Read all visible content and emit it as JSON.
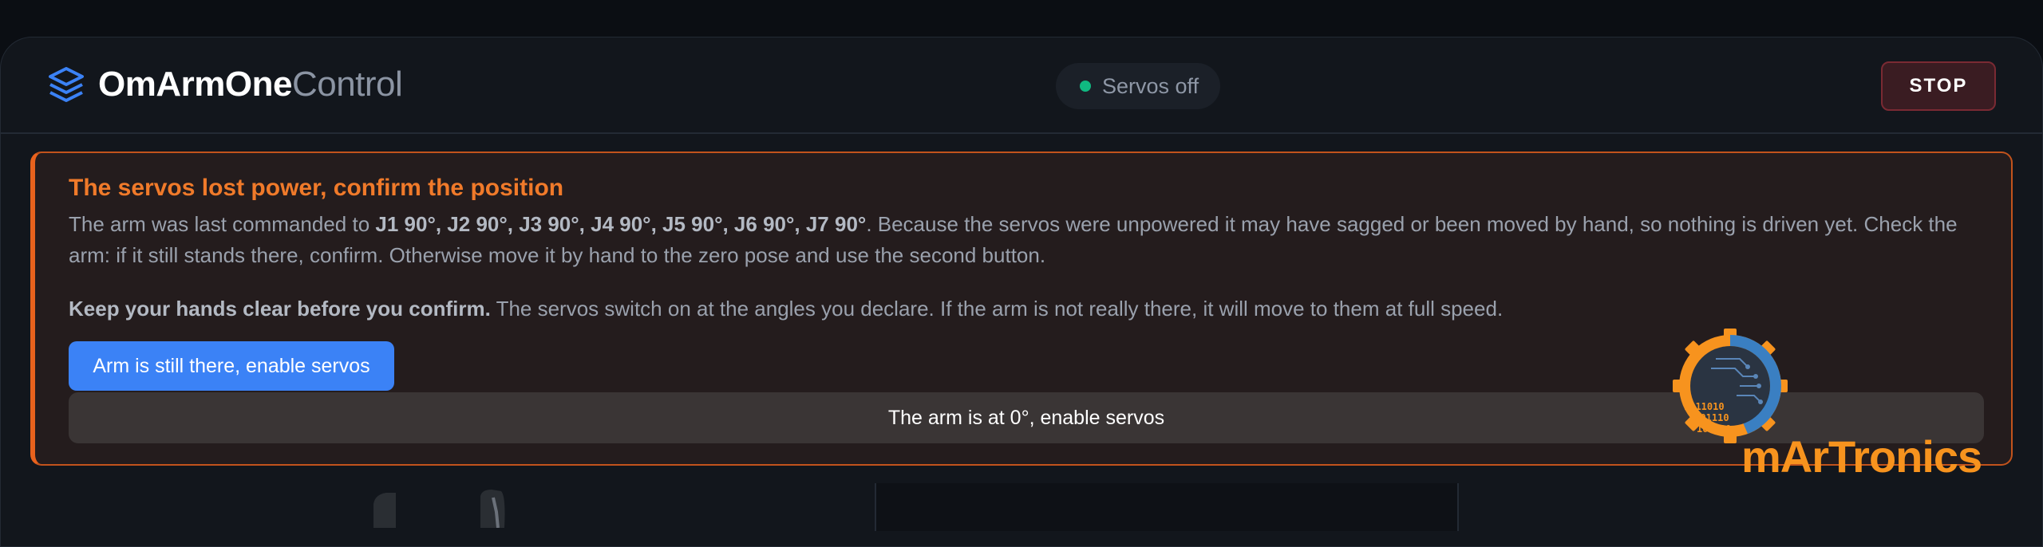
{
  "header": {
    "brand_bold": "OmArmOne",
    "brand_light": "Control",
    "status": "Servos off",
    "stop_label": "STOP"
  },
  "alert": {
    "title": "The servos lost power, confirm the position",
    "body_prefix": "The arm was last commanded to ",
    "angles": "J1 90°, J2 90°, J3 90°, J4 90°, J5 90°, J6 90°, J7 90°",
    "body_suffix": ". Because the servos were unpowered it may have sagged or been moved by hand, so nothing is driven yet. Check the arm: if it still stands there, confirm. Otherwise move it by hand to the zero pose and use the second button.",
    "warning_bold": "Keep your hands clear before you confirm.",
    "warning_rest": " The servos switch on at the angles you declare. If the arm is not really there, it will move to them at full speed.",
    "confirm_label": "Arm is still there, enable servos",
    "zero_label": "The arm is at 0°, enable servos"
  },
  "logo": {
    "text": "mArTronics",
    "binary": [
      "1011010",
      "1001110",
      "101010"
    ]
  },
  "colors": {
    "accent_blue": "#3b82f6",
    "alert_orange": "#e8621d",
    "status_green": "#10b981",
    "logo_orange": "#f7931e",
    "logo_blue": "#3a7fc2"
  }
}
